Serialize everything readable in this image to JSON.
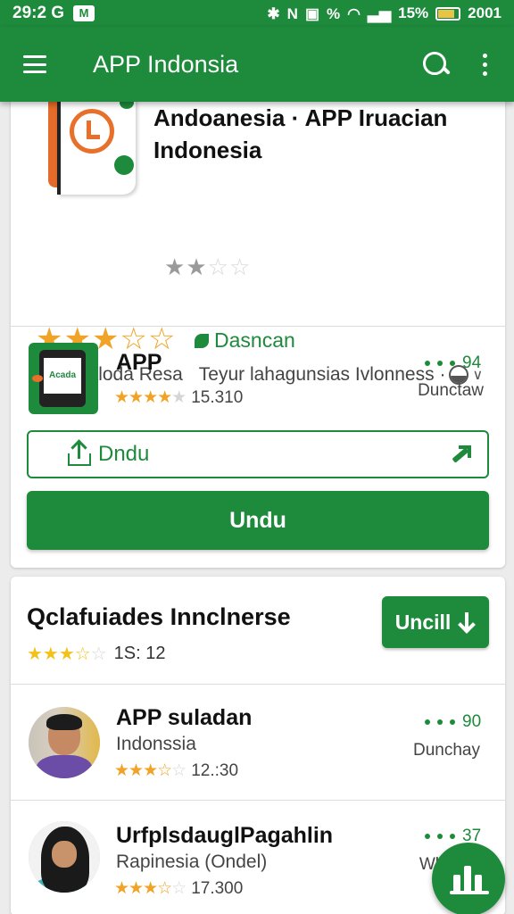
{
  "status_bar": {
    "time": "29:2 G",
    "mail_icon": "M",
    "battery_percent": "15%",
    "clock_right": "2001",
    "icons": [
      "bluetooth-icon",
      "nfc-icon",
      "vibrate-icon",
      "data-icon",
      "wifi-icon",
      "signal-icon",
      "battery-icon"
    ]
  },
  "app_bar": {
    "title": "APP Indonsia"
  },
  "header_app": {
    "title": "Andoanesia · APP Iruacian Indonesia",
    "rating_small": 2,
    "rating_big": 3.5,
    "download_status": "Dasncan",
    "meta_left": "Deittal Aloda Resa",
    "meta_right": "Teyur lahagunsias Ivlonness ·"
  },
  "featured_app": {
    "name": "APP",
    "icon_label": "Acada",
    "rating": 4,
    "rating_count": "15.310",
    "score": "94",
    "score_label": "Dunctaw",
    "outline_button": "Dndu",
    "solid_button": "Undu"
  },
  "section": {
    "title": "Qclafuiades Inncl​nerse",
    "rating": 3.5,
    "rating_count": "1S: 12",
    "button": "Uncill"
  },
  "list": [
    {
      "name": "APP suladan",
      "sub": "Indonssia",
      "rating": 3.5,
      "rating_count": "12.:30",
      "score": "90",
      "score_label": "Dunchay"
    },
    {
      "name": "UrfplsdauglPagahlin",
      "sub": "Rapinesia  (Ondel)",
      "rating": 3,
      "rating_count": "17.300",
      "score": "37",
      "score_label": "Wl"
    }
  ],
  "colors": {
    "primary": "#1e8a3c",
    "star": "#f0a326",
    "accent_orange": "#e8702a"
  }
}
